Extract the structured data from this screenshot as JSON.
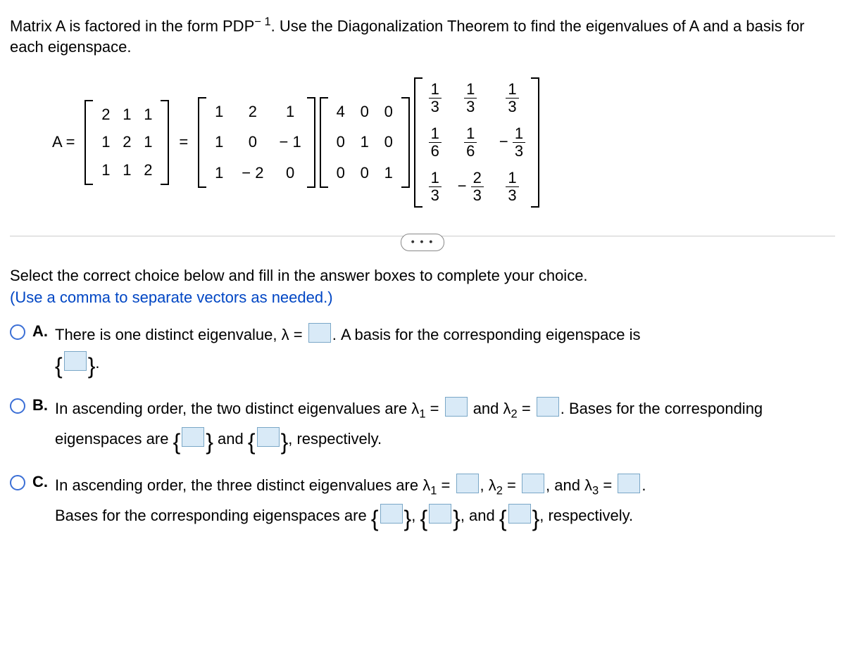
{
  "intro_line1": "Matrix A is factored in the form PDP",
  "intro_exp": "− 1",
  "intro_line2": ". Use the Diagonalization Theorem to find the eigenvalues of A and a basis for each eigenspace.",
  "eq_lhs": "A =",
  "eq_eqsign": "=",
  "matrixA": [
    "2",
    "1",
    "1",
    "1",
    "2",
    "1",
    "1",
    "1",
    "2"
  ],
  "matrixP": [
    "1",
    "2",
    "1",
    "1",
    "0",
    "− 1",
    "1",
    "− 2",
    "0"
  ],
  "matrixD": [
    "4",
    "0",
    "0",
    "0",
    "1",
    "0",
    "0",
    "0",
    "1"
  ],
  "matrixPinv": [
    {
      "sign": "",
      "num": "1",
      "den": "3"
    },
    {
      "sign": "",
      "num": "1",
      "den": "3"
    },
    {
      "sign": "",
      "num": "1",
      "den": "3"
    },
    {
      "sign": "",
      "num": "1",
      "den": "6"
    },
    {
      "sign": "",
      "num": "1",
      "den": "6"
    },
    {
      "sign": "−",
      "num": "1",
      "den": "3"
    },
    {
      "sign": "",
      "num": "1",
      "den": "3"
    },
    {
      "sign": "−",
      "num": "2",
      "den": "3"
    },
    {
      "sign": "",
      "num": "1",
      "den": "3"
    }
  ],
  "dots": "• • •",
  "prompt": "Select the correct choice below and fill in the answer boxes to complete your choice.",
  "hint": "(Use a comma to separate vectors as needed.)",
  "choiceA": {
    "label": "A.",
    "part1": "There is one distinct eigenvalue, λ = ",
    "part2": ". A basis for the corresponding eigenspace is",
    "part3": "."
  },
  "choiceB": {
    "label": "B.",
    "part1": "In ascending order, the two distinct eigenvalues are λ",
    "sub1": "1",
    "eq1": " = ",
    "and1": " and λ",
    "sub2": "2",
    "eq2": " = ",
    "part2": ". Bases for the corresponding eigenspaces are ",
    "and2": " and ",
    "part3": ", respectively."
  },
  "choiceC": {
    "label": "C.",
    "part1": "In ascending order, the three distinct eigenvalues are λ",
    "sub1": "1",
    "eq1": " = ",
    "c1": ", λ",
    "sub2": "2",
    "eq2": " = ",
    "c2": ", and λ",
    "sub3": "3",
    "eq3": " = ",
    "dot": ".",
    "part2": "Bases for the corresponding eigenspaces are ",
    "cma": ", ",
    "and": ", and ",
    "part3": ", respectively."
  }
}
